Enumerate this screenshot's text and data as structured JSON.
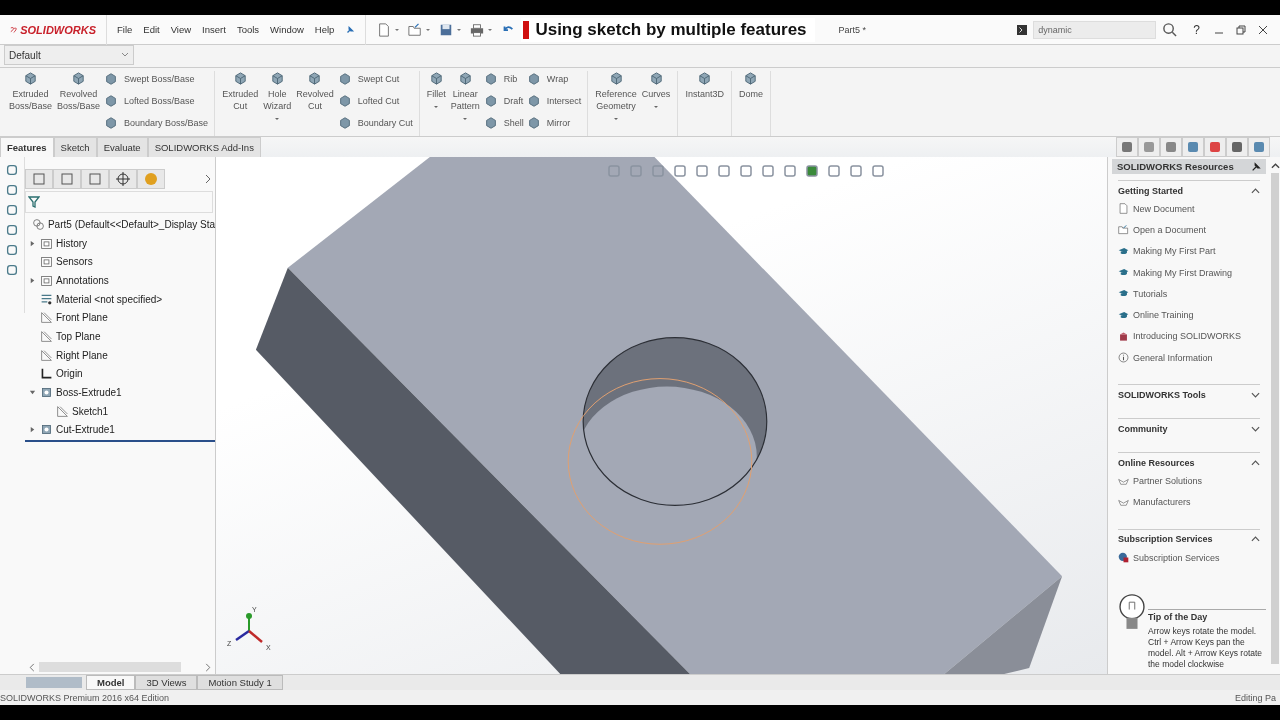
{
  "title_bar": {
    "logo": "SOLIDWORKS",
    "menus": [
      "File",
      "Edit",
      "View",
      "Insert",
      "Tools",
      "Window",
      "Help"
    ],
    "quick_access": [
      {
        "kind": "new"
      },
      {
        "kind": "open"
      },
      {
        "kind": "save"
      },
      {
        "kind": "print"
      },
      {
        "kind": "undo"
      }
    ],
    "caption": "Using sketch by multiple features",
    "document": "Part5 *",
    "search": {
      "value": "dynamic"
    },
    "help": "?"
  },
  "configuration": "Default",
  "ribbon": [
    {
      "items": [
        {
          "kind": "large",
          "label": "Extruded\nBoss/Base",
          "dropdown": false
        },
        {
          "kind": "large",
          "label": "Revolved\nBoss/Base",
          "dropdown": false
        },
        {
          "kind": "stack",
          "items": [
            "Swept Boss/Base",
            "Lofted Boss/Base",
            "Boundary Boss/Base"
          ]
        }
      ]
    },
    {
      "items": [
        {
          "kind": "large",
          "label": "Extruded\nCut",
          "dropdown": false
        },
        {
          "kind": "large",
          "label": "Hole\nWizard",
          "dropdown": true
        },
        {
          "kind": "large",
          "label": "Revolved\nCut",
          "dropdown": false
        },
        {
          "kind": "stack",
          "items": [
            "Swept Cut",
            "Lofted Cut",
            "Boundary Cut"
          ]
        }
      ]
    },
    {
      "items": [
        {
          "kind": "large",
          "label": "Fillet",
          "dropdown": true
        },
        {
          "kind": "large",
          "label": "Linear\nPattern",
          "dropdown": true
        },
        {
          "kind": "stack",
          "items": [
            "Rib",
            "Draft",
            "Shell"
          ]
        },
        {
          "kind": "stack",
          "items": [
            "Wrap",
            "Intersect",
            "Mirror"
          ]
        }
      ]
    },
    {
      "items": [
        {
          "kind": "large",
          "label": "Reference\nGeometry",
          "dropdown": true
        },
        {
          "kind": "large",
          "label": "Curves",
          "dropdown": true
        }
      ]
    },
    {
      "items": [
        {
          "kind": "large",
          "label": "Instant3D",
          "dropdown": false
        }
      ]
    },
    {
      "items": [
        {
          "kind": "large",
          "label": "Dome",
          "dropdown": false
        }
      ]
    }
  ],
  "command_tabs": [
    {
      "label": "Features",
      "selected": true
    },
    {
      "label": "Sketch",
      "selected": false
    },
    {
      "label": "Evaluate",
      "selected": false
    },
    {
      "label": "SOLIDWORKS Add-Ins",
      "selected": false
    }
  ],
  "tree": {
    "root": {
      "label": "Part5  (Default<<Default>_Display Sta",
      "kind": "part",
      "children": [
        {
          "label": "History",
          "kind": "folder",
          "expanded": false
        },
        {
          "label": "Sensors",
          "kind": "folder"
        },
        {
          "label": "Annotations",
          "kind": "folder",
          "expanded": false
        },
        {
          "label": "Material <not specified>",
          "kind": "material"
        },
        {
          "label": "Front Plane",
          "kind": "plane"
        },
        {
          "label": "Top Plane",
          "kind": "plane"
        },
        {
          "label": "Right Plane",
          "kind": "plane"
        },
        {
          "label": "Origin",
          "kind": "origin"
        },
        {
          "label": "Boss-Extrude1",
          "kind": "feature",
          "expanded": true,
          "children": [
            {
              "label": "Sketch1",
              "kind": "sketch"
            }
          ]
        },
        {
          "label": "Cut-Extrude1",
          "kind": "feature",
          "expanded": false
        }
      ]
    }
  },
  "task_pane": {
    "title": "SOLIDWORKS Resources",
    "sections": [
      {
        "title": "Getting Started",
        "expanded": true,
        "links": [
          {
            "label": "New Document",
            "kind": "document"
          },
          {
            "label": "Open a Document",
            "kind": "open"
          },
          {
            "label": "Making My First Part",
            "kind": "tutorial"
          },
          {
            "label": "Making My First Drawing",
            "kind": "tutorial"
          },
          {
            "label": "Tutorials",
            "kind": "tutorial"
          },
          {
            "label": "Online Training",
            "kind": "tutorial"
          },
          {
            "label": "Introducing SOLIDWORKS",
            "kind": "intro"
          },
          {
            "label": "General Information",
            "kind": "info"
          }
        ]
      },
      {
        "title": "SOLIDWORKS Tools",
        "expanded": false
      },
      {
        "title": "Community",
        "expanded": false
      },
      {
        "title": "Online Resources",
        "expanded": true,
        "links": [
          {
            "label": "Partner Solutions",
            "kind": "partner"
          },
          {
            "label": "Manufacturers",
            "kind": "partner"
          }
        ]
      },
      {
        "title": "Subscription Services",
        "expanded": true,
        "links": [
          {
            "label": "Subscription Services",
            "kind": "subscription"
          }
        ]
      }
    ],
    "tip": {
      "title": "Tip of the Day",
      "text": "Arrow keys rotate the model. Ctrl + Arrow Keys pan the model. Alt + Arrow Keys rotate the model clockwise"
    }
  },
  "triad": [
    "Y",
    "Z",
    "X"
  ],
  "bottom_tabs": [
    {
      "label": "Model",
      "selected": true
    },
    {
      "label": "3D Views",
      "selected": false
    },
    {
      "label": "Motion Study 1",
      "selected": false
    }
  ],
  "status_bar": {
    "left": "SOLIDWORKS Premium 2016 x64 Edition",
    "right": "Editing Pa"
  }
}
